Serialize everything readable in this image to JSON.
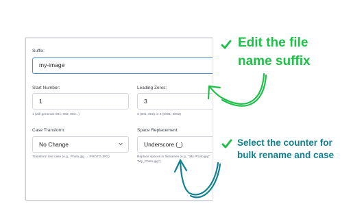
{
  "form": {
    "suffix": {
      "label": "Suffix:",
      "value": "my-image"
    },
    "start_number": {
      "label": "Start Number:",
      "value": "1",
      "hint": "1 (will generate 001, 002, 003...)"
    },
    "leading_zeros": {
      "label": "Leading Zeros:",
      "value": "3",
      "hint": "3 (001, 002) or 4 (0001, 0002)"
    },
    "case_transform": {
      "label": "Case Transform:",
      "value": "No Change",
      "hint": "Transform text case (e.g., Photo.jpg → PHOTO.JPG)"
    },
    "space_replacement": {
      "label": "Space Replacement:",
      "value": "Underscore (_)",
      "hint_line1": "Replace spaces in filenames (e.g., \"My Photo.jpg\" →",
      "hint_line2": "\"My_Photo.jpg\")"
    }
  },
  "callouts": {
    "top_line1": "Edit the file",
    "top_line2": "name suffix",
    "bottom_line1": "Select the counter for",
    "bottom_line2": "bulk rename and case"
  },
  "icons": {
    "check": "check-icon",
    "chevron": "chevron-down-icon",
    "arrow": "hand-drawn-arrow"
  },
  "colors": {
    "green": "#1fbf4a",
    "teal": "#11808f",
    "focus_border": "#4a90d9",
    "field_border": "#d3d7dc"
  }
}
